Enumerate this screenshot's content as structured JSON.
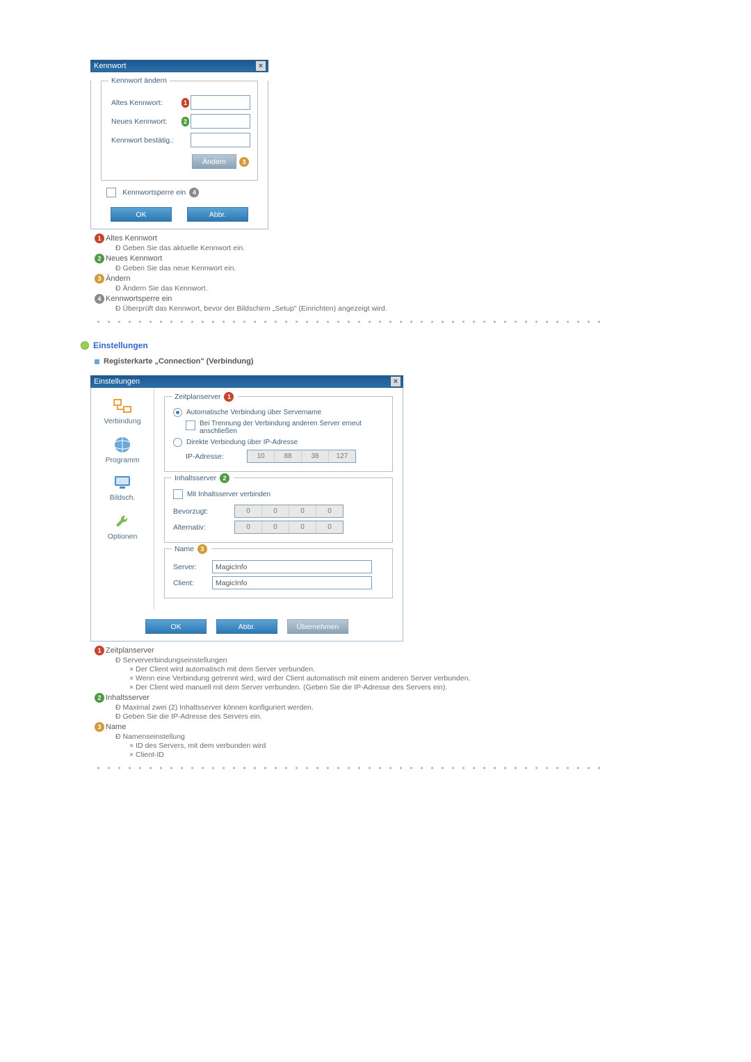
{
  "kennwort_dialog": {
    "title": "Kennwort",
    "legend": "Kennwort ändern",
    "old_label": "Altes Kennwort:",
    "new_label": "Neues Kennwort:",
    "confirm_label": "Kennwort bestätig.:",
    "change_btn": "Ändern",
    "lock_label": "Kennwortsperre ein",
    "ok": "OK",
    "cancel": "Abbr."
  },
  "kennwort_notes": {
    "n1_title": "Altes Kennwort",
    "n1_sub": "Ð  Geben Sie das aktuelle Kennwort ein.",
    "n2_title": "Neues Kennwort",
    "n2_sub": "Ð  Geben Sie das neue Kennwort ein.",
    "n3_title": "Ändern",
    "n3_sub": "Ð  Ändern Sie das Kennwort.",
    "n4_title": "Kennwortsperre ein",
    "n4_sub": "Ð  Überprüft das Kennwort, bevor der Bildschirm „Setup\" (Einrichten) angezeigt wird."
  },
  "sec_heading": "Einstellungen",
  "sub_heading": "Registerkarte „Connection\" (Verbindung)",
  "settings_dialog": {
    "title": "Einstellungen",
    "side": {
      "conn": "Verbindung",
      "prog": "Programm",
      "screen": "Bildsch.",
      "opt": "Optionen"
    },
    "sched": {
      "legend": "Zeitplanserver",
      "auto": "Automatische Verbindung über Servername",
      "reconnect": "Bei Trennung der Verbindung anderen Server erneut anschließen",
      "direct": "Direkte Verbindung über IP-Adresse",
      "ip_label": "IP-Adresse:",
      "ip": [
        "10",
        "88",
        "38",
        "127"
      ]
    },
    "content": {
      "legend": "Inhaltsserver",
      "connect": "Mit Inhaltsserver verbinden",
      "pref_label": "Bevorzugt:",
      "alt_label": "Alternativ:",
      "zeros": [
        "0",
        "0",
        "0",
        "0"
      ]
    },
    "name": {
      "legend": "Name",
      "server_label": "Server:",
      "client_label": "Client:",
      "server": "MagicInfo",
      "client": "MagicInfo"
    },
    "ok": "OK",
    "cancel": "Abbr.",
    "apply": "Übernehmen"
  },
  "settings_notes": {
    "n1_title": "Zeitplanserver",
    "n1_sub": "Ð  Serververbindungseinstellungen",
    "n1_b1": "×  Der Client wird automatisch mit dem Server verbunden.",
    "n1_b2": "×  Wenn eine Verbindung getrennt wird, wird der Client automatisch mit einem anderen Server verbunden.",
    "n1_b3": "×  Der Client wird manuell mit dem Server verbunden. (Geben Sie die IP-Adresse des Servers ein).",
    "n2_title": "Inhaltsserver",
    "n2_sub1": "Ð  Maximal zwei (2) Inhaltsserver können konfiguriert werden.",
    "n2_sub2": "Ð  Geben Sie die IP-Adresse des Servers ein.",
    "n3_title": "Name",
    "n3_sub": "Ð  Namenseinstellung",
    "n3_b1": "×  ID des Servers, mit dem verbunden wird",
    "n3_b2": "×  Client-ID"
  }
}
